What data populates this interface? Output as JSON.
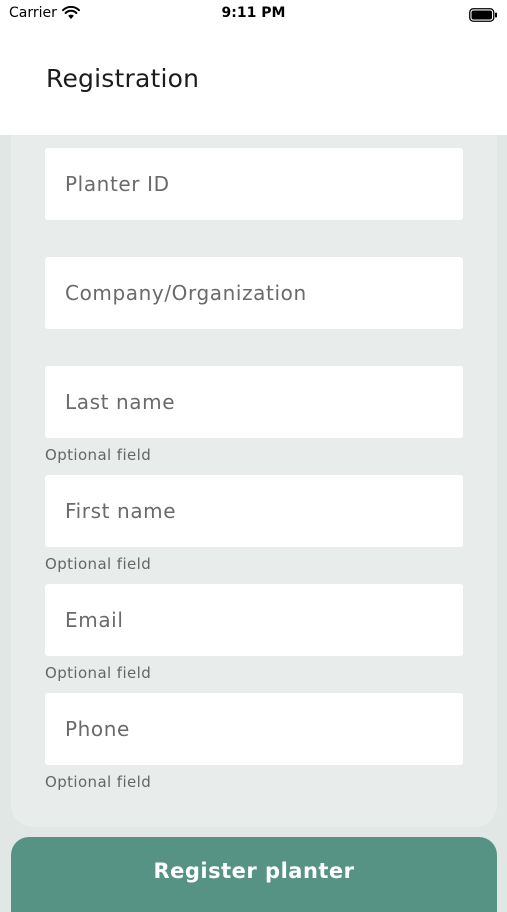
{
  "status_bar": {
    "carrier": "Carrier",
    "time": "9:11 PM",
    "icons": [
      "wifi-icon",
      "battery-icon"
    ]
  },
  "header": {
    "title": "Registration"
  },
  "form": {
    "fields": [
      {
        "placeholder": "Planter ID",
        "value": "",
        "helper": ""
      },
      {
        "placeholder": "Company/Organization",
        "value": "",
        "helper": ""
      },
      {
        "placeholder": "Last name",
        "value": "",
        "helper": "Optional field"
      },
      {
        "placeholder": "First name",
        "value": "",
        "helper": "Optional field"
      },
      {
        "placeholder": "Email",
        "value": "",
        "helper": "Optional field"
      },
      {
        "placeholder": "Phone",
        "value": "",
        "helper": "Optional field"
      }
    ]
  },
  "register_button": {
    "label": "Register planter"
  },
  "colors": {
    "accent": "#569384",
    "background": "#e0e7e4",
    "card": "#e8ecea",
    "field": "#ffffff"
  }
}
